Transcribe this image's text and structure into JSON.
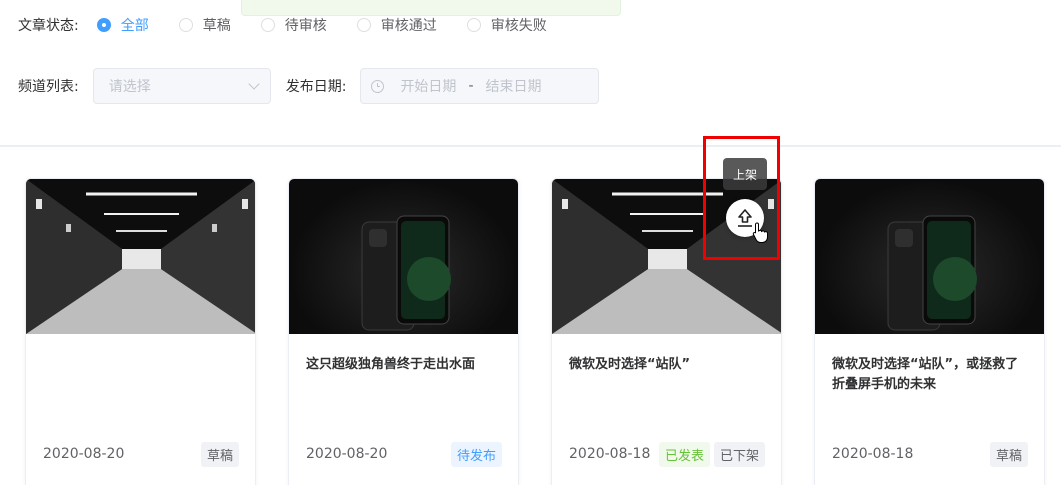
{
  "filters": {
    "status_label": "文章状态:",
    "status_options": [
      "全部",
      "草稿",
      "待审核",
      "审核通过",
      "审核失败"
    ],
    "status_selected": "全部",
    "channel_label": "频道列表:",
    "channel_placeholder": "请选择",
    "date_label": "发布日期:",
    "date_start_placeholder": "开始日期",
    "date_separator": "-",
    "date_end_placeholder": "结束日期"
  },
  "cards": [
    {
      "image": "server-room",
      "title": "",
      "date": "2020-08-20",
      "tags": [
        {
          "label": "草稿",
          "kind": "draft"
        }
      ]
    },
    {
      "image": "phone",
      "title": "这只超级独角兽终于走出水面",
      "date": "2020-08-20",
      "tags": [
        {
          "label": "待发布",
          "kind": "pending"
        }
      ]
    },
    {
      "image": "server-room",
      "title": "微软及时选择“站队”",
      "date": "2020-08-18",
      "tags": [
        {
          "label": "已发表",
          "kind": "published"
        },
        {
          "label": "已下架",
          "kind": "off"
        }
      ]
    },
    {
      "image": "phone",
      "title": "微软及时选择“站队”，或拯救了折叠屏手机的未来",
      "date": "2020-08-18",
      "tags": [
        {
          "label": "草稿",
          "kind": "draft"
        }
      ]
    }
  ],
  "hover_action": {
    "tooltip": "上架",
    "icon": "upload-icon"
  },
  "colors": {
    "primary": "#409eff",
    "success": "#67c23a",
    "highlight": "#f10000"
  }
}
